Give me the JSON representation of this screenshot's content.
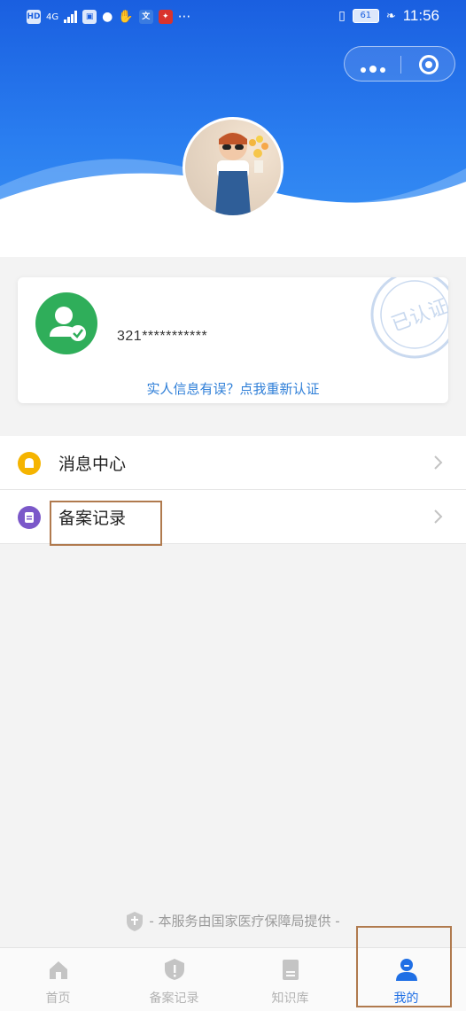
{
  "status_bar": {
    "left_badges": [
      "HD",
      "4G"
    ],
    "battery": "61",
    "time": "11:56"
  },
  "capsule": {
    "more_icon": "more-dots-icon",
    "close_icon": "target-circle-icon"
  },
  "profile": {
    "id_masked": "321***********",
    "verify_link": "实人信息有误？点我重新认证",
    "stamp_text": "已认证"
  },
  "menu": {
    "items": [
      {
        "label": "消息中心",
        "icon": "bell-icon",
        "icon_color": "#f5b400"
      },
      {
        "label": "备案记录",
        "icon": "record-icon",
        "icon_color": "#7b58c9"
      }
    ]
  },
  "footer": {
    "note": "- 本服务由国家医疗保障局提供 -"
  },
  "tabbar": {
    "tabs": [
      {
        "label": "首页",
        "icon": "home-icon",
        "active": false
      },
      {
        "label": "备案记录",
        "icon": "record-shield-icon",
        "active": false
      },
      {
        "label": "知识库",
        "icon": "book-icon",
        "active": false
      },
      {
        "label": "我的",
        "icon": "user-icon",
        "active": true
      }
    ],
    "active_color": "#1f6fe5"
  },
  "colors": {
    "header_blue": "#1a5fe0",
    "card_green": "#2fae5a",
    "link_blue": "#2f7fd8",
    "highlight_border": "#b07a4e"
  }
}
